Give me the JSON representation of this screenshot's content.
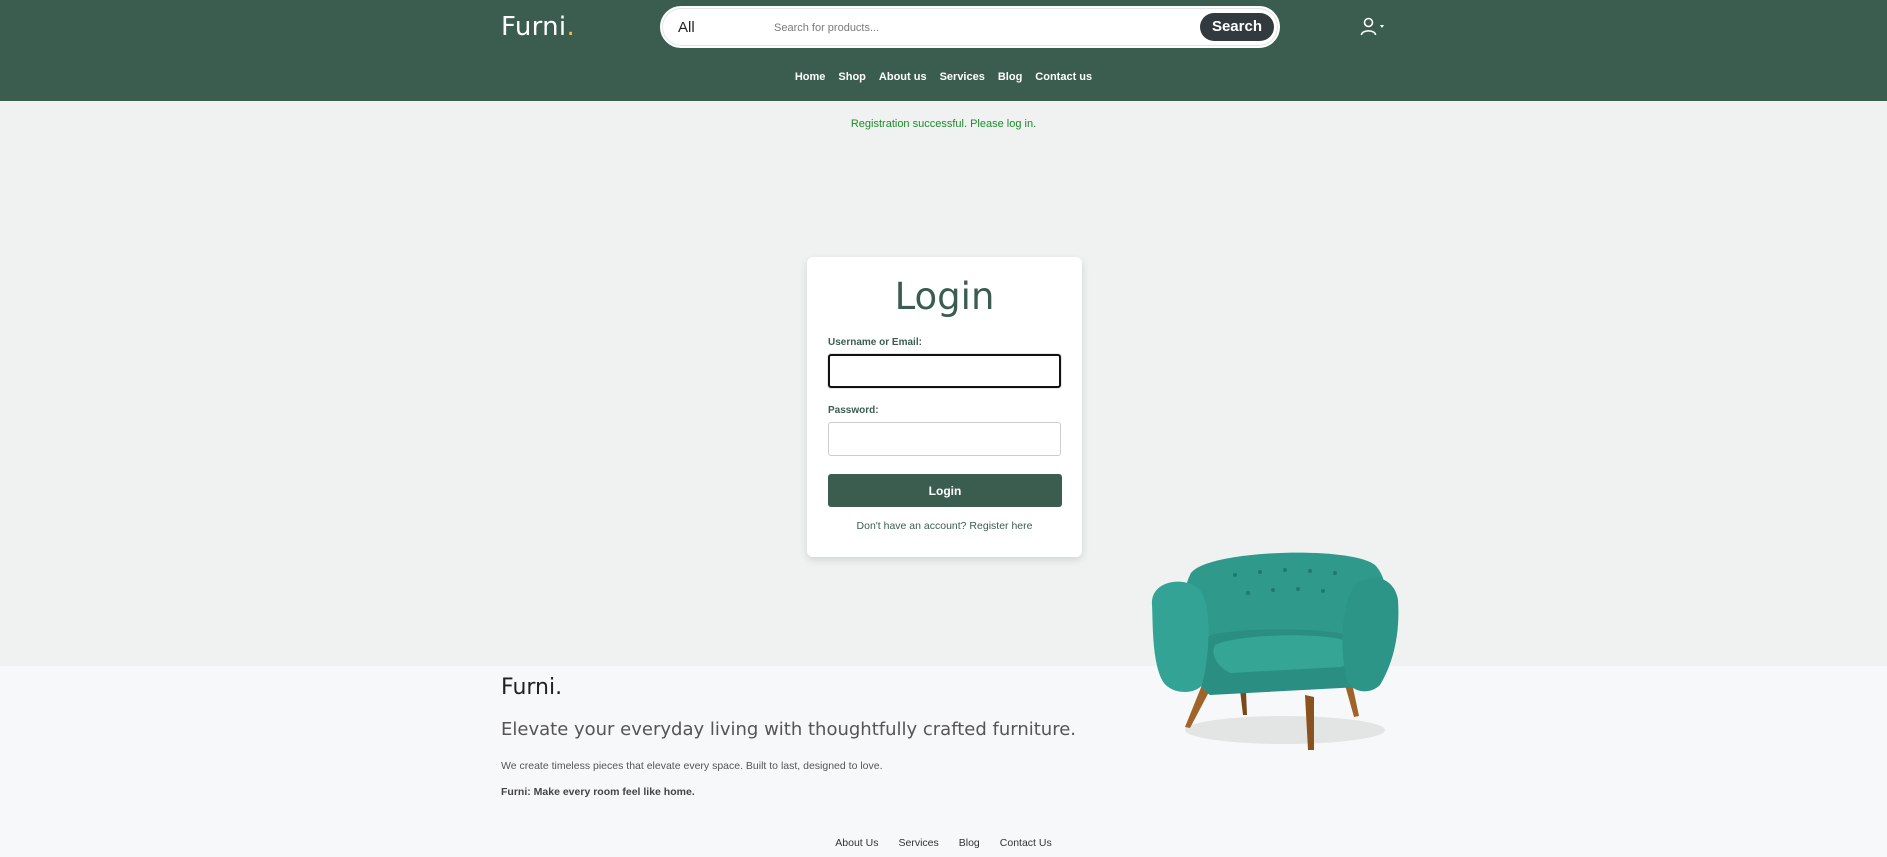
{
  "header": {
    "logo_text": "Furni",
    "logo_dot": ".",
    "search": {
      "category": "All",
      "placeholder": "Search for products...",
      "button_label": "Search"
    },
    "user_icon": "user-icon"
  },
  "nav": {
    "items": [
      "Home",
      "Shop",
      "About us",
      "Services",
      "Blog",
      "Contact us"
    ]
  },
  "flash": {
    "message": "Registration successful. Please log in."
  },
  "login": {
    "title": "Login",
    "username_label": "Username or Email:",
    "username_value": "",
    "password_label": "Password:",
    "password_value": "",
    "submit_label": "Login",
    "register_text": "Don't have an account? Register here"
  },
  "footer": {
    "logo": "Furni.",
    "tagline": "Elevate your everyday living with thoughtfully crafted furniture.",
    "description": "We create timeless pieces that elevate every space. Built to last, designed to love.",
    "motto": "Furni: Make every room feel like home.",
    "links": [
      "About Us",
      "Services",
      "Blog",
      "Contact Us"
    ]
  },
  "colors": {
    "brand_green": "#3b5d50",
    "accent_yellow": "#f9bf29",
    "success_green": "#1f8a2a",
    "chair_teal": "#2a9d8f"
  }
}
